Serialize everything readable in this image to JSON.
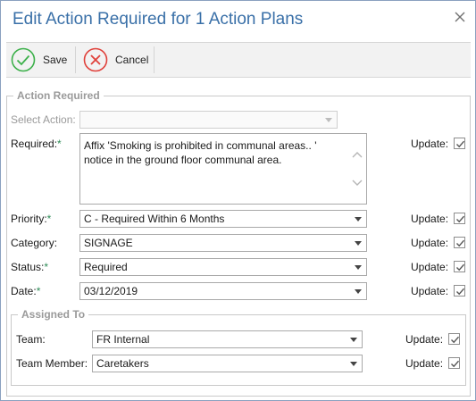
{
  "dialog": {
    "title": "Edit Action Required for 1 Action Plans"
  },
  "toolbar": {
    "save_label": "Save",
    "cancel_label": "Cancel"
  },
  "action_required": {
    "legend": "Action Required",
    "select_action": {
      "label": "Select Action:",
      "value": ""
    },
    "required": {
      "label": "Required:",
      "value": "Affix 'Smoking is prohibited in communal areas.. '\nnotice in the ground floor communal area.",
      "update_label": "Update:",
      "update_checked": true
    },
    "priority": {
      "label": "Priority:",
      "value": "C - Required Within 6 Months",
      "update_label": "Update:",
      "update_checked": true
    },
    "category": {
      "label": "Category:",
      "value": "SIGNAGE",
      "update_label": "Update:",
      "update_checked": true
    },
    "status": {
      "label": "Status:",
      "value": "Required",
      "update_label": "Update:",
      "update_checked": true
    },
    "date": {
      "label": "Date:",
      "value": "03/12/2019",
      "update_label": "Update:",
      "update_checked": true
    }
  },
  "assigned_to": {
    "legend": "Assigned To",
    "team": {
      "label": "Team:",
      "value": "FR Internal",
      "update_label": "Update:",
      "update_checked": true
    },
    "team_member": {
      "label": "Team Member:",
      "value": "Caretakers",
      "update_label": "Update:",
      "update_checked": true
    }
  },
  "required_marker": "*",
  "colors": {
    "title": "#3a70a8",
    "required_marker": "#2e8b57",
    "save_icon": "#3cb04a",
    "cancel_icon": "#e0403a"
  }
}
